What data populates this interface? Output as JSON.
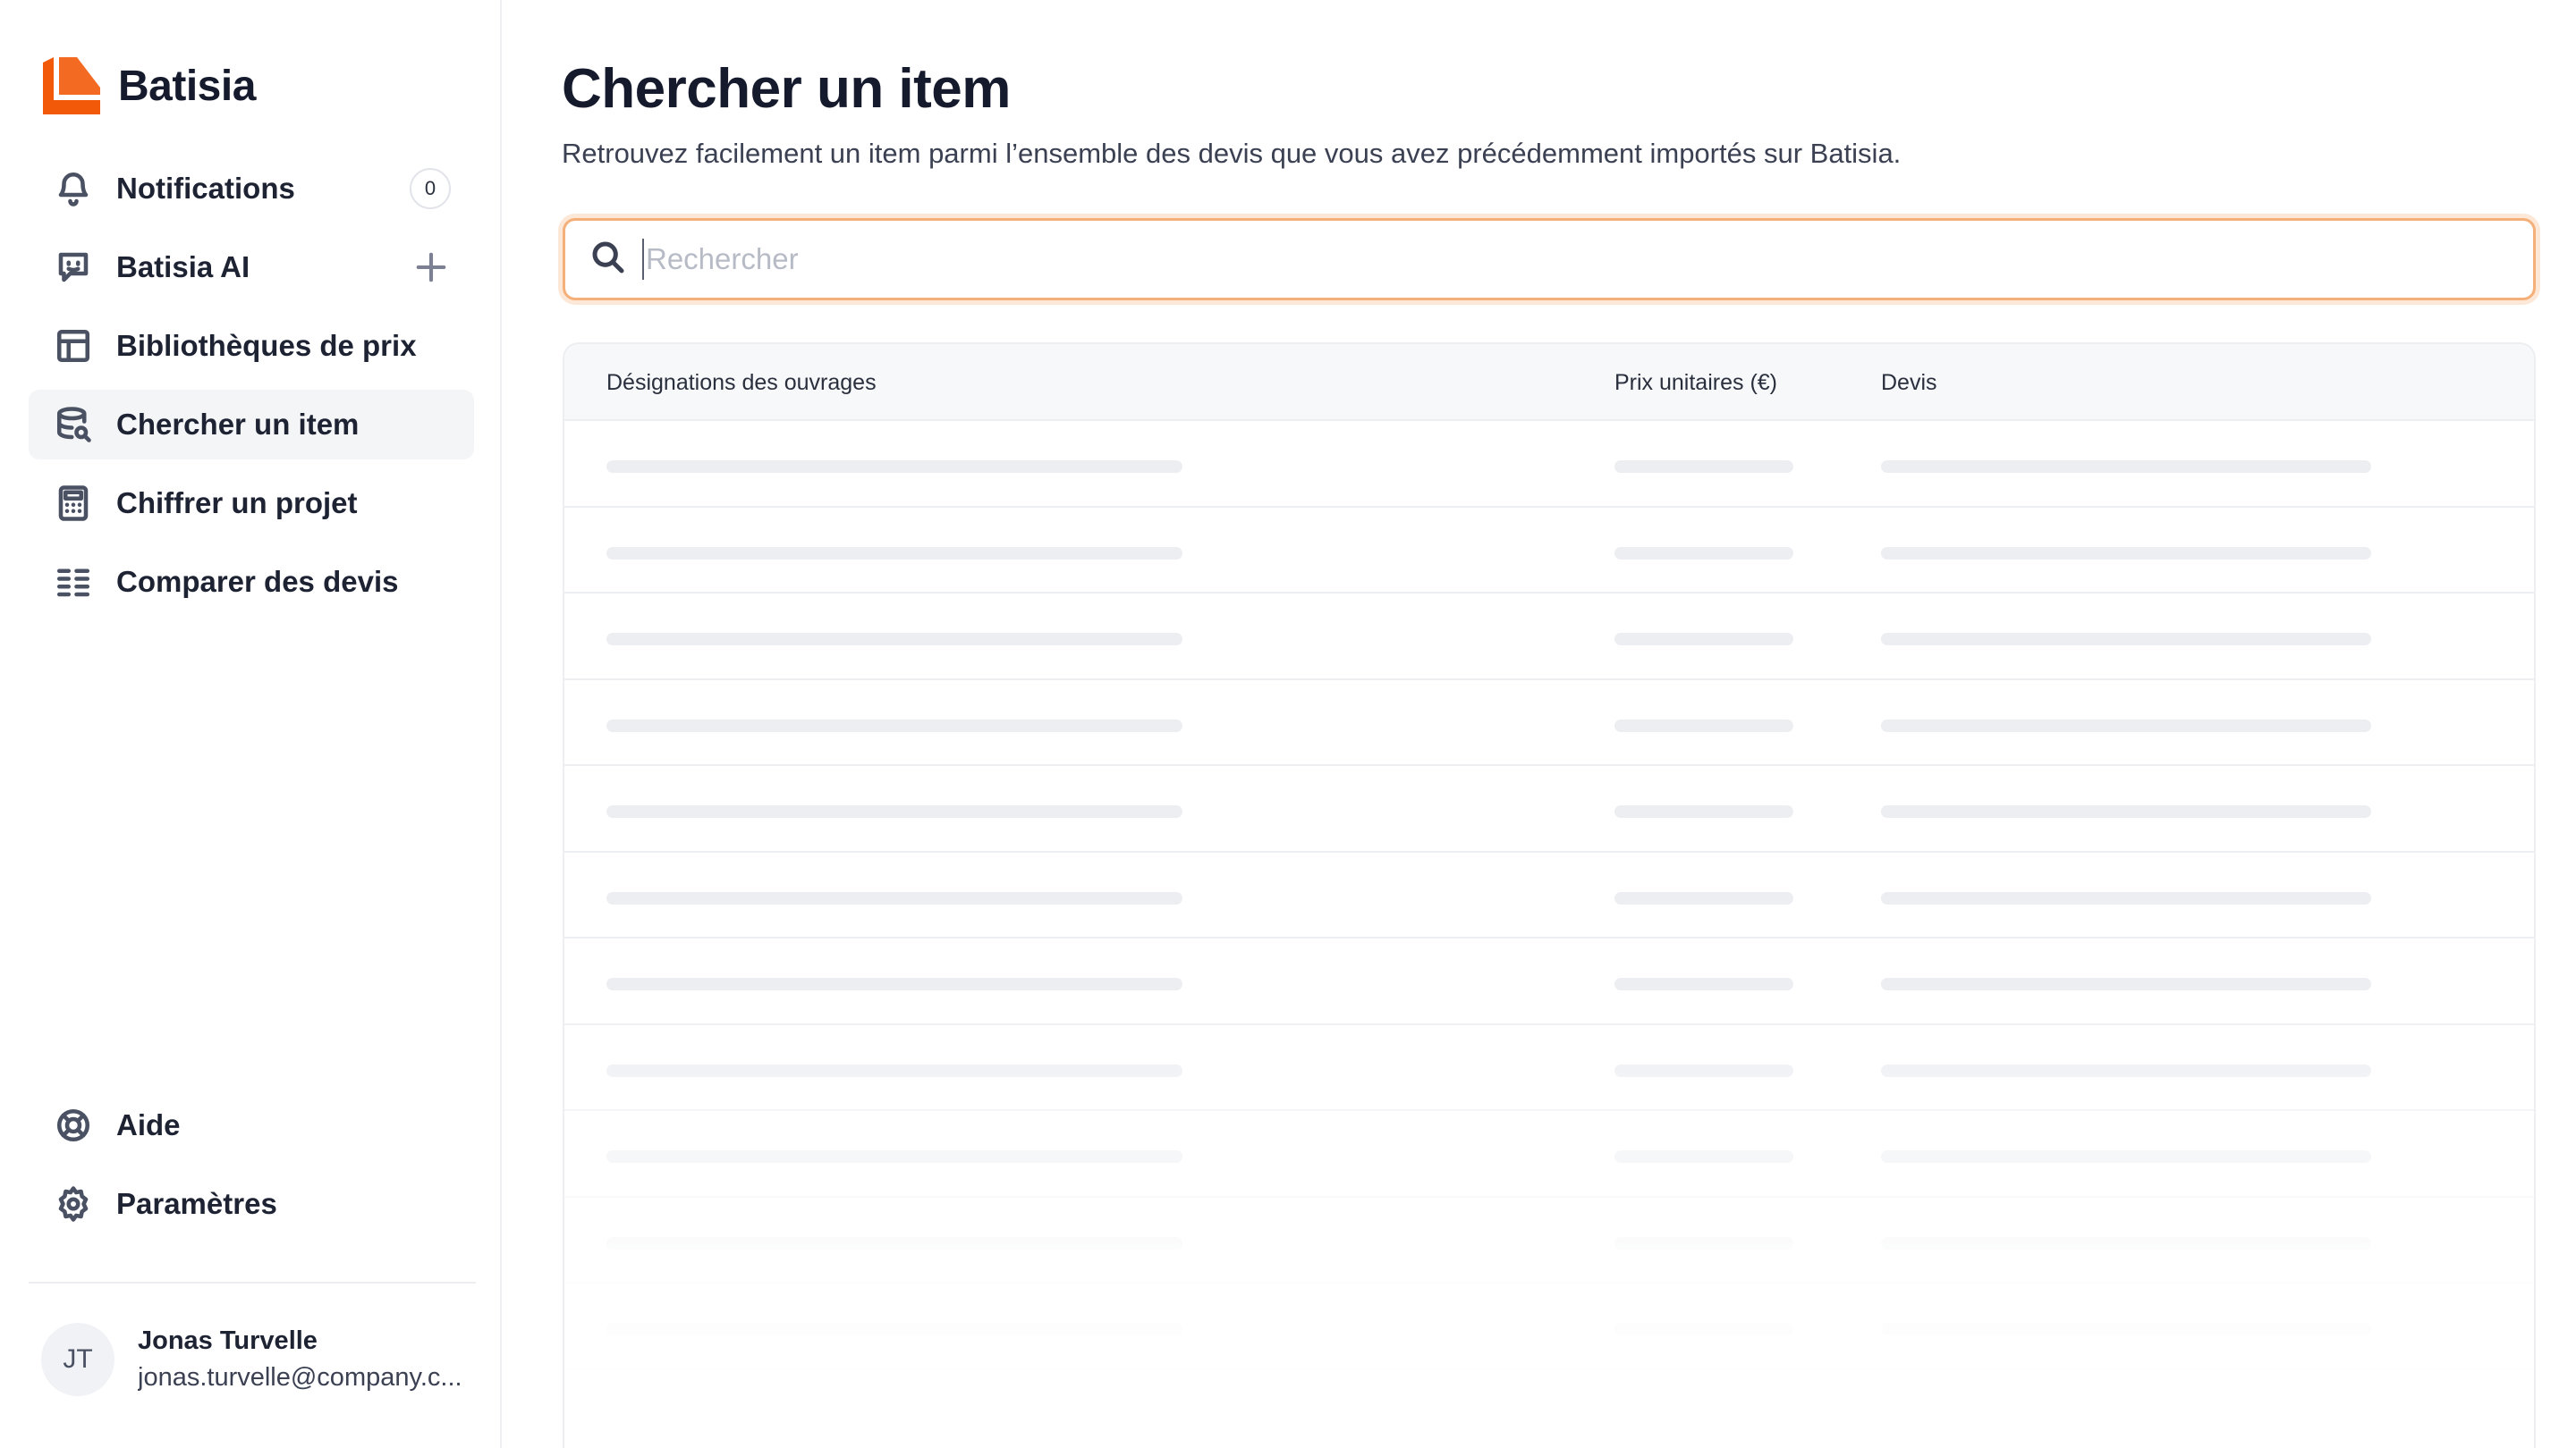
{
  "app": {
    "name": "Batisia",
    "brand_color": "#f25a0a"
  },
  "sidebar": {
    "items": [
      {
        "label": "Notifications",
        "icon": "bell-icon",
        "badge": "0"
      },
      {
        "label": "Batisia AI",
        "icon": "chat-bot-icon",
        "action_icon": "plus-icon"
      },
      {
        "label": "Bibliothèques de prix",
        "icon": "table-grid-icon"
      },
      {
        "label": "Chercher un item",
        "icon": "database-search-icon",
        "active": true
      },
      {
        "label": "Chiffrer un projet",
        "icon": "calculator-icon"
      },
      {
        "label": "Comparer des devis",
        "icon": "list-compare-icon"
      }
    ],
    "bottom_items": [
      {
        "label": "Aide",
        "icon": "lifebuoy-icon"
      },
      {
        "label": "Paramètres",
        "icon": "gear-icon"
      }
    ],
    "user": {
      "initials": "JT",
      "name": "Jonas Turvelle",
      "email": "jonas.turvelle@company.c..."
    }
  },
  "main": {
    "title": "Chercher un item",
    "subtitle": "Retrouvez facilement un item parmi l’ensemble des devis que vous avez précédemment importés sur Batisia.",
    "search": {
      "placeholder": "Rechercher",
      "value": ""
    },
    "table": {
      "columns": [
        "Désignations des ouvrages",
        "Prix unitaires (€)",
        "Devis"
      ],
      "loading_rows": 11
    }
  }
}
